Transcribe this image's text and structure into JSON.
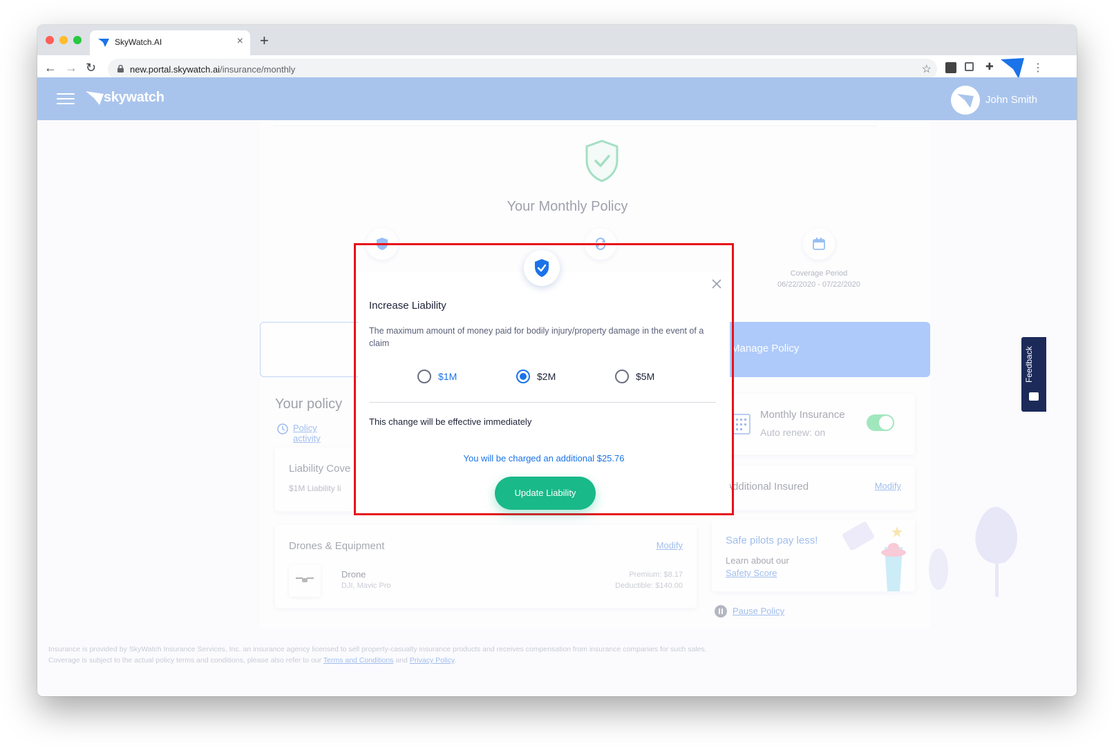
{
  "browser": {
    "tab_title": "SkyWatch.AI",
    "url_domain": "new.portal.skywatch.ai",
    "url_path": "/insurance/monthly"
  },
  "header": {
    "logo_text": "skywatch",
    "user_name": "John Smith"
  },
  "policy": {
    "title": "Your Monthly Policy",
    "coverage_label": "Coverage Period",
    "coverage_dates": "06/22/2020 - 07/22/2020",
    "manage_button": "Manage Policy"
  },
  "details": {
    "section_title": "Your policy",
    "activity_link": "Policy activity",
    "liability_title": "Liability Cove",
    "liability_sub": "$1M Liability li",
    "monthly_title": "Monthly Insurance",
    "monthly_sub": "Auto renew: on",
    "auto_renew_on": true,
    "additional_title": "Additional Insured",
    "modify": "Modify",
    "drones_title": "Drones & Equipment",
    "drone_name": "Drone",
    "drone_model": "DJI, Mavic Pro",
    "drone_premium": "Premium: $8.17",
    "drone_deductible": "Deductible: $140.00",
    "safe_title": "Safe pilots pay less!",
    "safe_text": "Learn about our",
    "safe_link": "Safety Score",
    "pause": "Pause Policy"
  },
  "footer": {
    "text_1": "Insurance is provided by SkyWatch Insurance Services, Inc. an insurance agency licensed to sell property-casualty insurance products and receives compensation from insurance companies for such sales. Coverage is subject to the actual policy terms and conditions, please also refer to our ",
    "terms": "Terms and Conditions",
    "and": " and ",
    "privacy": "Privacy Policy",
    "end": "."
  },
  "feedback": {
    "label": "Feedback"
  },
  "modal": {
    "title": "Increase Liability",
    "description": "The maximum amount of money paid for bodily injury/property damage in the event of a claim",
    "options": [
      {
        "label": "$1M",
        "selected": false
      },
      {
        "label": "$2M",
        "selected": true
      },
      {
        "label": "$5M",
        "selected": false
      }
    ],
    "effective": "This change will be effective immediately",
    "charge": "You will be charged an additional $25.76",
    "button": "Update Liability"
  },
  "colors": {
    "header_bg": "#a9c4ec",
    "accent_blue": "#1a73e8",
    "cta_green": "#19b989",
    "highlight_red": "#e8111a",
    "feedback_bg": "#1c2a5a"
  }
}
